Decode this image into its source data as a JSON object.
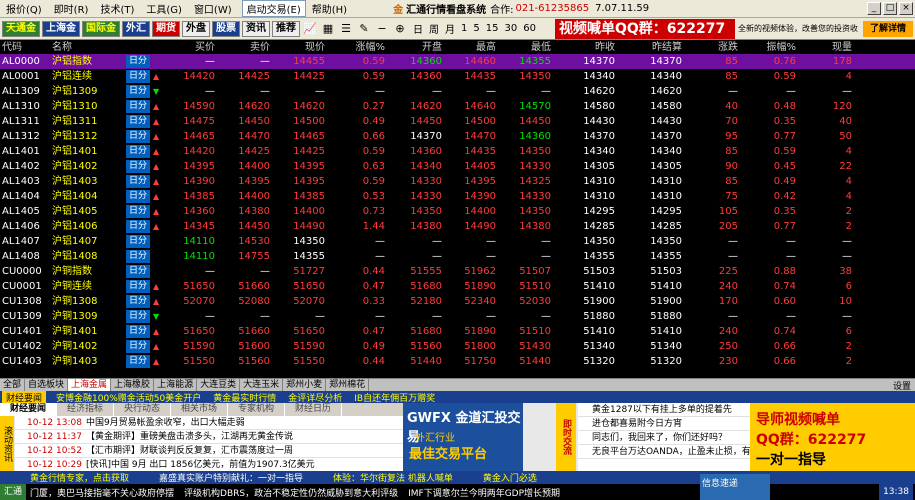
{
  "menu": {
    "items": [
      "报价(Q)",
      "即时(R)",
      "技术(T)",
      "工具(G)",
      "窗口(W)"
    ],
    "active_box": "启动交易(E)",
    "help": "帮助(H)",
    "brand_logo": "金",
    "brand_name": "汇通行情看盘系统",
    "cooperation": "合作:",
    "phone": "021-61235865",
    "version": "7.07.11.59"
  },
  "toolbar": {
    "buttons": [
      "天通金",
      "上海金",
      "国际金",
      "外汇",
      "期货",
      "外盘",
      "股票",
      "资讯",
      "推荐"
    ],
    "periods": [
      "日",
      "周",
      "月",
      "1",
      "5",
      "15",
      "30",
      "60"
    ],
    "ad_text": "视频喊单QQ群：622277",
    "ad_note": "全新的视频体验，改善您的投资收益",
    "ad_button": "了解详情"
  },
  "table": {
    "headers": [
      "代码",
      "名称",
      "买价",
      "卖价",
      "现价",
      "涨幅%",
      "开盘",
      "最高",
      "最低",
      "昨收",
      "昨结算",
      "涨跌",
      "振幅%",
      "现量"
    ],
    "rows": [
      {
        "code": "AL0000",
        "name": "沪铝指数",
        "tag": "日分",
        "arrow": "",
        "buy": "—",
        "sell": "—",
        "last": "14455",
        "pct": "0.59",
        "open": "14360",
        "high": "14460",
        "low": "14355",
        "prev": "14370",
        "settle": "14370",
        "chg": "85",
        "amp": "0.76",
        "vol": "178",
        "sel": true
      },
      {
        "code": "AL0001",
        "name": "沪铝连续",
        "tag": "日分",
        "arrow": "up",
        "buy": "14420",
        "sell": "14425",
        "last": "14425",
        "pct": "0.59",
        "open": "14360",
        "high": "14435",
        "low": "14350",
        "prev": "14340",
        "settle": "14340",
        "chg": "85",
        "amp": "0.59",
        "vol": "4"
      },
      {
        "code": "AL1309",
        "name": "沪铝1309",
        "tag": "日分",
        "arrow": "down",
        "buy": "—",
        "sell": "—",
        "last": "—",
        "pct": "—",
        "open": "—",
        "high": "—",
        "low": "—",
        "prev": "14620",
        "settle": "14620",
        "chg": "—",
        "amp": "—",
        "vol": "—"
      },
      {
        "code": "AL1310",
        "name": "沪铝1310",
        "tag": "日分",
        "arrow": "up",
        "buy": "14590",
        "sell": "14620",
        "last": "14620",
        "pct": "0.27",
        "open": "14620",
        "high": "14640",
        "low": "14570",
        "prev": "14580",
        "settle": "14580",
        "chg": "40",
        "amp": "0.48",
        "vol": "120"
      },
      {
        "code": "AL1311",
        "name": "沪铝1311",
        "tag": "日分",
        "arrow": "up",
        "buy": "14475",
        "sell": "14450",
        "last": "14500",
        "pct": "0.49",
        "open": "14450",
        "high": "14500",
        "low": "14450",
        "prev": "14430",
        "settle": "14430",
        "chg": "70",
        "amp": "0.35",
        "vol": "40"
      },
      {
        "code": "AL1312",
        "name": "沪铝1312",
        "tag": "日分",
        "arrow": "up",
        "buy": "14465",
        "sell": "14470",
        "last": "14465",
        "pct": "0.66",
        "open": "14370",
        "high": "14470",
        "low": "14360",
        "prev": "14370",
        "settle": "14370",
        "chg": "95",
        "amp": "0.77",
        "vol": "50"
      },
      {
        "code": "AL1401",
        "name": "沪铝1401",
        "tag": "日分",
        "arrow": "up",
        "buy": "14420",
        "sell": "14425",
        "last": "14425",
        "pct": "0.59",
        "open": "14360",
        "high": "14435",
        "low": "14350",
        "prev": "14340",
        "settle": "14340",
        "chg": "85",
        "amp": "0.59",
        "vol": "4"
      },
      {
        "code": "AL1402",
        "name": "沪铝1402",
        "tag": "日分",
        "arrow": "up",
        "buy": "14395",
        "sell": "14400",
        "last": "14395",
        "pct": "0.63",
        "open": "14340",
        "high": "14405",
        "low": "14330",
        "prev": "14305",
        "settle": "14305",
        "chg": "90",
        "amp": "0.45",
        "vol": "22"
      },
      {
        "code": "AL1403",
        "name": "沪铝1403",
        "tag": "日分",
        "arrow": "up",
        "buy": "14390",
        "sell": "14395",
        "last": "14395",
        "pct": "0.59",
        "open": "14330",
        "high": "14395",
        "low": "14325",
        "prev": "14310",
        "settle": "14310",
        "chg": "85",
        "amp": "0.49",
        "vol": "4"
      },
      {
        "code": "AL1404",
        "name": "沪铝1404",
        "tag": "日分",
        "arrow": "up",
        "buy": "14385",
        "sell": "14400",
        "last": "14385",
        "pct": "0.53",
        "open": "14330",
        "high": "14390",
        "low": "14330",
        "prev": "14310",
        "settle": "14310",
        "chg": "75",
        "amp": "0.42",
        "vol": "4"
      },
      {
        "code": "AL1405",
        "name": "沪铝1405",
        "tag": "日分",
        "arrow": "up",
        "buy": "14360",
        "sell": "14380",
        "last": "14400",
        "pct": "0.73",
        "open": "14350",
        "high": "14400",
        "low": "14350",
        "prev": "14295",
        "settle": "14295",
        "chg": "105",
        "amp": "0.35",
        "vol": "2"
      },
      {
        "code": "AL1406",
        "name": "沪铝1406",
        "tag": "日分",
        "arrow": "up",
        "buy": "14345",
        "sell": "14450",
        "last": "14490",
        "pct": "1.44",
        "open": "14380",
        "high": "14490",
        "low": "14380",
        "prev": "14285",
        "settle": "14285",
        "chg": "205",
        "amp": "0.77",
        "vol": "2"
      },
      {
        "code": "AL1407",
        "name": "沪铝1407",
        "tag": "日分",
        "arrow": "",
        "buy": "14110",
        "sell": "14530",
        "last": "14350",
        "pct": "—",
        "open": "—",
        "high": "—",
        "low": "—",
        "prev": "14350",
        "settle": "14350",
        "chg": "—",
        "amp": "—",
        "vol": "—"
      },
      {
        "code": "AL1408",
        "name": "沪铝1408",
        "tag": "日分",
        "arrow": "",
        "buy": "14110",
        "sell": "14755",
        "last": "14355",
        "pct": "—",
        "open": "—",
        "high": "—",
        "low": "—",
        "prev": "14355",
        "settle": "14355",
        "chg": "—",
        "amp": "—",
        "vol": "—"
      },
      {
        "code": "CU0000",
        "name": "沪铜指数",
        "tag": "日分",
        "arrow": "",
        "buy": "—",
        "sell": "—",
        "last": "51727",
        "pct": "0.44",
        "open": "51555",
        "high": "51962",
        "low": "51507",
        "prev": "51503",
        "settle": "51503",
        "chg": "225",
        "amp": "0.88",
        "vol": "38"
      },
      {
        "code": "CU0001",
        "name": "沪铜连续",
        "tag": "日分",
        "arrow": "up",
        "buy": "51650",
        "sell": "51660",
        "last": "51650",
        "pct": "0.47",
        "open": "51680",
        "high": "51890",
        "low": "51510",
        "prev": "51410",
        "settle": "51410",
        "chg": "240",
        "amp": "0.74",
        "vol": "6"
      },
      {
        "code": "CU1308",
        "name": "沪铜1308",
        "tag": "日分",
        "arrow": "up",
        "buy": "52070",
        "sell": "52080",
        "last": "52070",
        "pct": "0.33",
        "open": "52180",
        "high": "52340",
        "low": "52030",
        "prev": "51900",
        "settle": "51900",
        "chg": "170",
        "amp": "0.60",
        "vol": "10"
      },
      {
        "code": "CU1309",
        "name": "沪铜1309",
        "tag": "日分",
        "arrow": "down",
        "buy": "—",
        "sell": "—",
        "last": "—",
        "pct": "—",
        "open": "—",
        "high": "—",
        "low": "—",
        "prev": "51880",
        "settle": "51880",
        "chg": "—",
        "amp": "—",
        "vol": "—"
      },
      {
        "code": "CU1401",
        "name": "沪铜1401",
        "tag": "日分",
        "arrow": "up",
        "buy": "51650",
        "sell": "51660",
        "last": "51650",
        "pct": "0.47",
        "open": "51680",
        "high": "51890",
        "low": "51510",
        "prev": "51410",
        "settle": "51410",
        "chg": "240",
        "amp": "0.74",
        "vol": "6"
      },
      {
        "code": "CU1402",
        "name": "沪铜1402",
        "tag": "日分",
        "arrow": "up",
        "buy": "51590",
        "sell": "51600",
        "last": "51590",
        "pct": "0.49",
        "open": "51560",
        "high": "51800",
        "low": "51430",
        "prev": "51340",
        "settle": "51340",
        "chg": "250",
        "amp": "0.66",
        "vol": "2"
      },
      {
        "code": "CU1403",
        "name": "沪铜1403",
        "tag": "日分",
        "arrow": "up",
        "buy": "51550",
        "sell": "51560",
        "last": "51550",
        "pct": "0.44",
        "open": "51440",
        "high": "51750",
        "low": "51440",
        "prev": "51320",
        "settle": "51320",
        "chg": "230",
        "amp": "0.66",
        "vol": "2"
      }
    ]
  },
  "market_tabs": {
    "items": [
      "全部",
      "自选板块",
      "上海金属",
      "上海橡胶",
      "上海能源",
      "大连豆类",
      "大连玉米",
      "郑州小麦",
      "郑州棉花"
    ],
    "active": "上海金属",
    "settings": "设置"
  },
  "news_strip": {
    "head": "财经要闻",
    "items": [
      "安博金融100%赠金活动50美金开户",
      "黄金最实时行情",
      "金评详尽分析",
      "IB自还年佣百万赠奖"
    ]
  },
  "news_tabs": [
    "财经要闻",
    "经济指标",
    "央行动态",
    "相关市场",
    "专家机构",
    "财经日历"
  ],
  "side_label": "滚动资讯",
  "news": [
    {
      "dt": "10-12 13:08",
      "text": "中国9月贸易帐盈余收窄，出口大幅走弱"
    },
    {
      "dt": "10-12 11:37",
      "text": "【黄金期评】重磅美盘击溃多头，江湖再无黄金传说"
    },
    {
      "dt": "10-12 10:52",
      "text": "【汇市期评】财联谈判反反复复，汇市震荡度过一周"
    },
    {
      "dt": "10-12 10:29",
      "text": "[快讯]中国 9月 出口 1856亿美元，前值为1907.3亿美元"
    }
  ],
  "banner": {
    "l1": "GWFX 金道汇投交易",
    "l2": "外汇行业",
    "l3": "最佳交易平台"
  },
  "side2_label": "即时交流",
  "pitems": [
    "黄金1287以下有挂上多单的提着先",
    "进仓都喜易附今日方宵",
    "同志们，我回来了，你们还好吗？",
    "无良平台万达OANDA，止盈未止损，有图有"
  ],
  "promo": {
    "l1": "导师视频喊单",
    "l2": "QQ群：622277",
    "l3": "一对一指导"
  },
  "statusbar": {
    "items": [
      "黄金行情专家，点击获取",
      "嘉盛真实账户特别献礼：一对一指导",
      "体验：华尔街复法 机器人喊单",
      "黄金入门必选"
    ]
  },
  "ticker": {
    "start": "汇通",
    "items": [
      "门厦，奥巴马接指毫不关心政府停摆",
      "评级机构DBRS，政治不稳定性仍然威胁到意大利评级",
      "IMF下调意尔兰今明两年GDP增长预期"
    ],
    "popup": "信息速递",
    "clock": "13:38"
  },
  "colors": {
    "selected_row": "#6e0fa0",
    "up": "#ff3c3c",
    "down": "#00e000",
    "accent": "#c00000"
  }
}
